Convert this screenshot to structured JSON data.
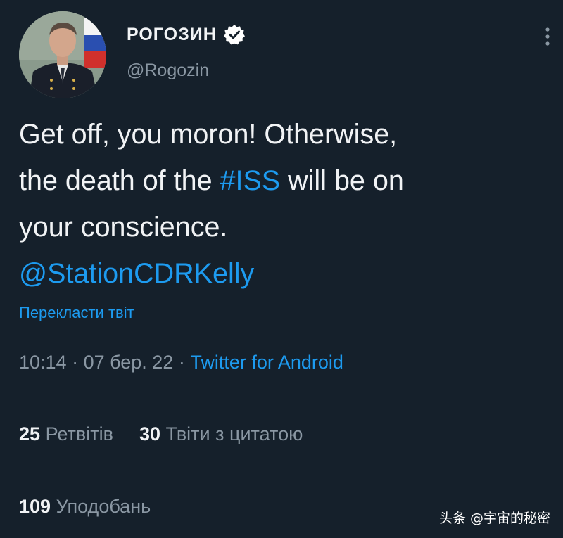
{
  "author": {
    "display_name": "РОГОЗИН",
    "handle": "@Rogozin",
    "verified": true,
    "avatar_icon": "profile-photo"
  },
  "tweet": {
    "text_line1": "Get off, you moron!  Otherwise,",
    "text_line2_before": "the death of the ",
    "hashtag": "#ISS",
    "text_line2_after": " will be on",
    "text_line3": "your conscience.",
    "mention": "@StationCDRKelly"
  },
  "translate_label": "Перекласти твіт",
  "meta": {
    "time": "10:14",
    "separator": " · ",
    "date": "07 бер. 22",
    "source": "Twitter for Android"
  },
  "stats": {
    "retweets_count": "25",
    "retweets_label": "Ретвітів",
    "quotes_count": "30",
    "quotes_label": "Твіти з цитатою",
    "likes_count": "109",
    "likes_label": "Уподобань"
  },
  "watermark": "头条 @宇宙的秘密",
  "colors": {
    "background": "#15202b",
    "accent": "#1d9bf0",
    "text": "#f1f3f5",
    "muted": "#8a97a3",
    "divider": "#38444d"
  }
}
